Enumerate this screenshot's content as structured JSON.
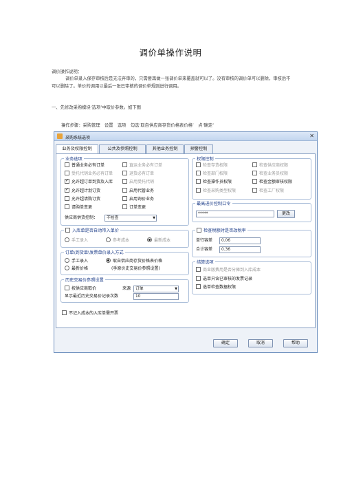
{
  "doc": {
    "title": "调价单操作说明",
    "para1": "调价操作说明：",
    "para2": "调价单录入保存审核后是无法弃审的，只需要再做一张调价单来覆盖就可以了。没有审核的调价单可以删除，审核后不可以删除了。单价的调用以最后一张已审核的调价单规则进行调用。",
    "para3": "一、先修改采购模块‘选项’中取价参数。如下图",
    "para4": "操作步骤：采购管理　设置　选项　勾选‘取自供应商存货价格表价格’　点‘确定’"
  },
  "window": {
    "title": "采购系统选项",
    "close": "✕",
    "tabs": [
      "业务及权限控制",
      "公共及参照控制",
      "其他业务控制",
      "预警控制"
    ],
    "business": {
      "legend": "业务选项",
      "left": [
        {
          "label": "普通业务必有订单",
          "checked": false,
          "dim": false
        },
        {
          "label": "受托代销业务必有订单",
          "checked": false,
          "dim": true
        },
        {
          "label": "允许超订单到货及入库",
          "checked": true,
          "dim": false
        },
        {
          "label": "允许超计划订货",
          "checked": true,
          "dim": false
        },
        {
          "label": "允许超请购订货",
          "checked": false,
          "dim": false
        },
        {
          "label": "请购单变更",
          "checked": false,
          "dim": false
        }
      ],
      "right": [
        {
          "label": "直运业务必有订单",
          "checked": false,
          "dim": true
        },
        {
          "label": "退货必有订单",
          "checked": false,
          "dim": true
        },
        {
          "label": "启用受托代销",
          "checked": false,
          "dim": true
        },
        {
          "label": "启用代管业务",
          "checked": false,
          "dim": false
        },
        {
          "label": "启用询价业务",
          "checked": false,
          "dim": false
        },
        {
          "label": "订单变更",
          "checked": false,
          "dim": false
        }
      ],
      "supplier_label": "供应商供货控制：",
      "supplier_value": "不检查"
    },
    "auth": {
      "legend": "权限控制",
      "left": [
        {
          "label": "检查存货权限",
          "checked": false,
          "dim": true
        },
        {
          "label": "检查部门权限",
          "checked": false,
          "dim": true
        },
        {
          "label": "检查操作员权限",
          "checked": false,
          "dim": false
        },
        {
          "label": "检查采购类型权限",
          "checked": false,
          "dim": true
        }
      ],
      "right": [
        {
          "label": "检查供应商权限",
          "checked": false,
          "dim": true
        },
        {
          "label": "检查业务员权限",
          "checked": false,
          "dim": true
        },
        {
          "label": "检查金额审核权限",
          "checked": false,
          "dim": false
        },
        {
          "label": "检查工厂权限",
          "checked": false,
          "dim": true
        }
      ]
    },
    "password": {
      "legend": "最高进价控制口令",
      "value": "*****",
      "button": "更改"
    },
    "autofill": {
      "legend": "入库单是否自动带入单价",
      "options": [
        {
          "label": "手工录入",
          "on": false
        },
        {
          "label": "参考成本",
          "on": false
        },
        {
          "label": "最新成本",
          "on": true
        }
      ]
    },
    "tax": {
      "legend": "检查税额时是否改税率",
      "rows": [
        {
          "label": "单行容差",
          "value": "0.06"
        },
        {
          "label": "合计容差",
          "value": "0.36"
        }
      ]
    },
    "price_mode": {
      "legend": "订单\\到货单\\发票单价录入方式",
      "options": [
        {
          "label": "手工录入",
          "on": false
        },
        {
          "label": "取自供应商存货价格表价格",
          "on": true
        },
        {
          "label": "最新价格",
          "on": false
        },
        {
          "label": "(手原价史交易价参照设置)",
          "on": false
        }
      ]
    },
    "history": {
      "legend": "历史交易价参照设置",
      "by_supplier": "按供应商取价",
      "source_label": "来源",
      "source_value": "订单",
      "count_label": "显示最近历史交易价记录次数",
      "count_value": "10"
    },
    "settle": {
      "legend": "结算选项",
      "items": [
        {
          "label": "商业版费用是否分摊到入库成本",
          "checked": false,
          "dim": true
        },
        {
          "label": "选单只含已审核的发票记录",
          "checked": false,
          "dim": false
        },
        {
          "label": "选单检查数据权限",
          "checked": false,
          "dim": false
        }
      ]
    },
    "nocost": "不记入成本的入库单需开票",
    "buttons": {
      "ok": "确定",
      "cancel": "取消",
      "help": "帮助"
    }
  }
}
